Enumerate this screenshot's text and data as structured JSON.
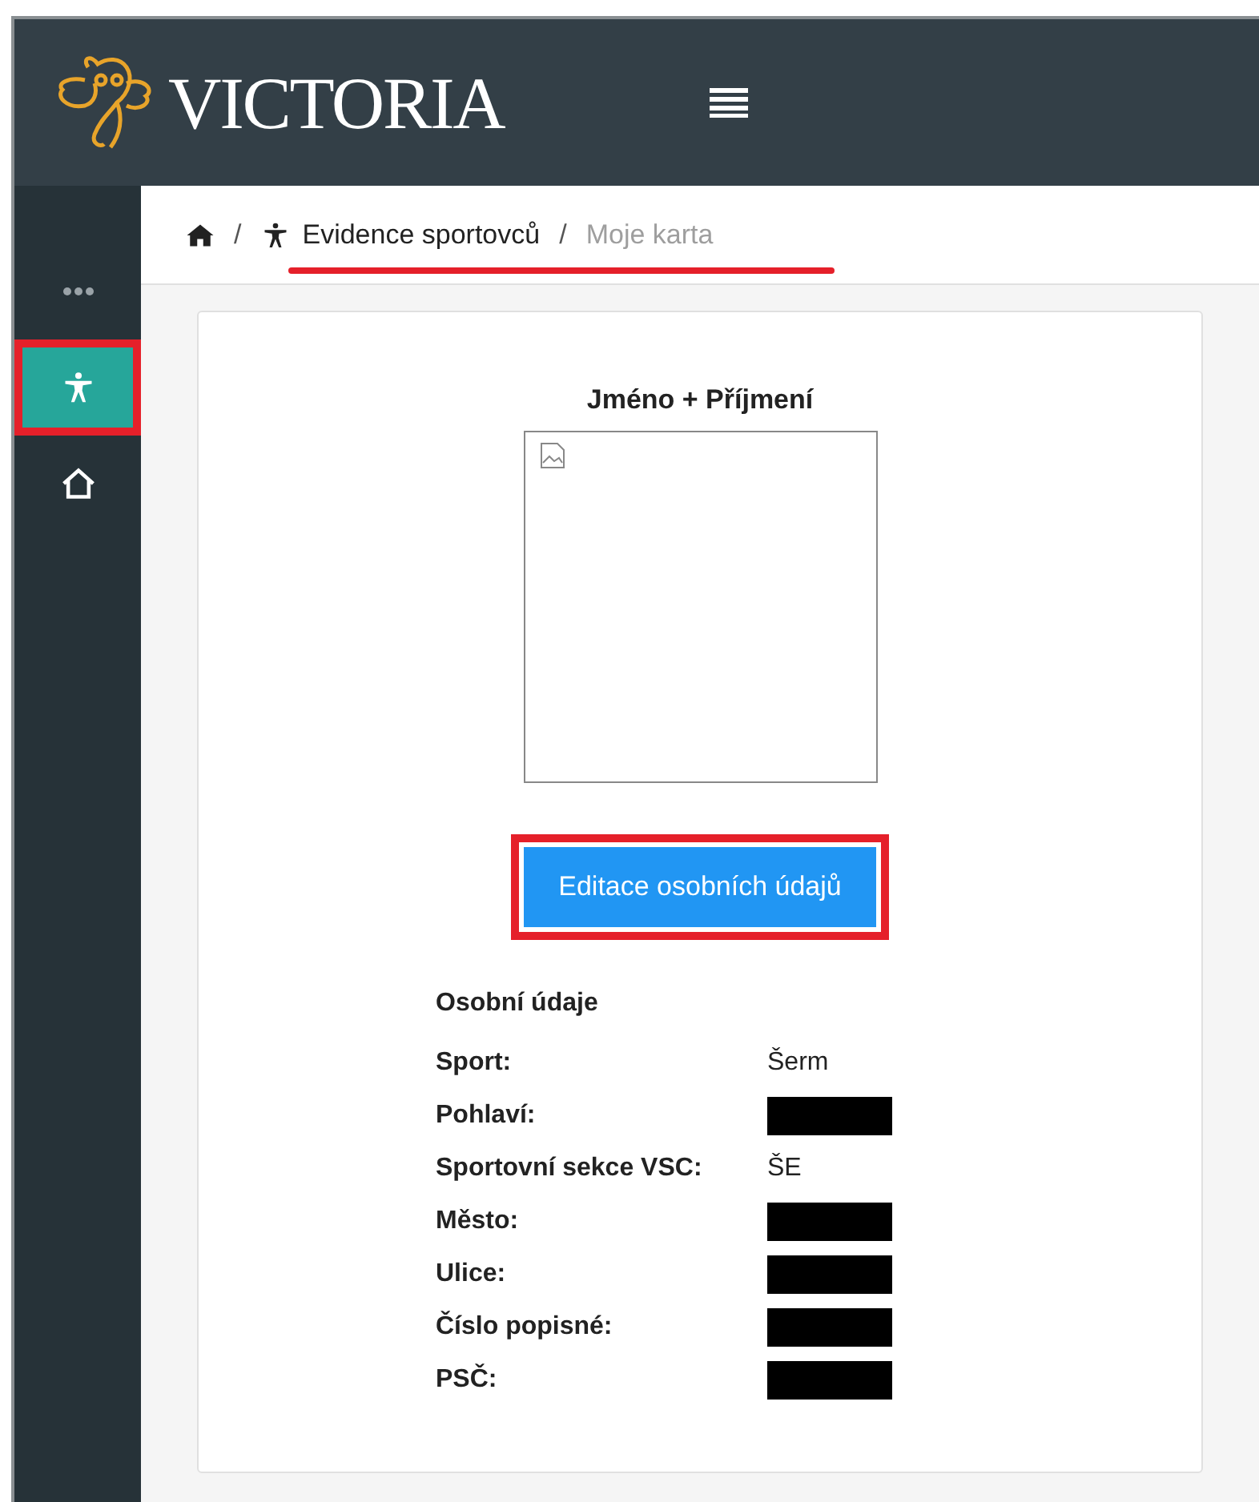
{
  "header": {
    "logo": "VICTORIA"
  },
  "sidebar": {
    "items": [
      {
        "kind": "more",
        "selected": false,
        "highlighted": false
      },
      {
        "kind": "person",
        "selected": true,
        "highlighted": true
      },
      {
        "kind": "home",
        "selected": false,
        "highlighted": false
      }
    ]
  },
  "breadcrumb": {
    "items": [
      {
        "kind": "home"
      },
      {
        "kind": "link",
        "label": "Evidence sportovců"
      },
      {
        "kind": "current",
        "label": "Moje karta"
      }
    ],
    "separator": "/",
    "underlined": true
  },
  "card": {
    "name": "Jméno + Příjmení",
    "button": {
      "label": "Editace osobních údajů",
      "highlighted": true
    },
    "section_title": "Osobní údaje",
    "fields": [
      {
        "label": "Sport:",
        "kind": "text",
        "value": "Šerm"
      },
      {
        "label": "Pohlaví:",
        "kind": "redacted"
      },
      {
        "label": "Sportovní sekce VSC:",
        "kind": "text",
        "value": "ŠE"
      },
      {
        "label": "Město:",
        "kind": "redacted"
      },
      {
        "label": "Ulice:",
        "kind": "redacted"
      },
      {
        "label": "Číslo popisné:",
        "kind": "redacted"
      },
      {
        "label": "PSČ:",
        "kind": "redacted"
      }
    ]
  }
}
